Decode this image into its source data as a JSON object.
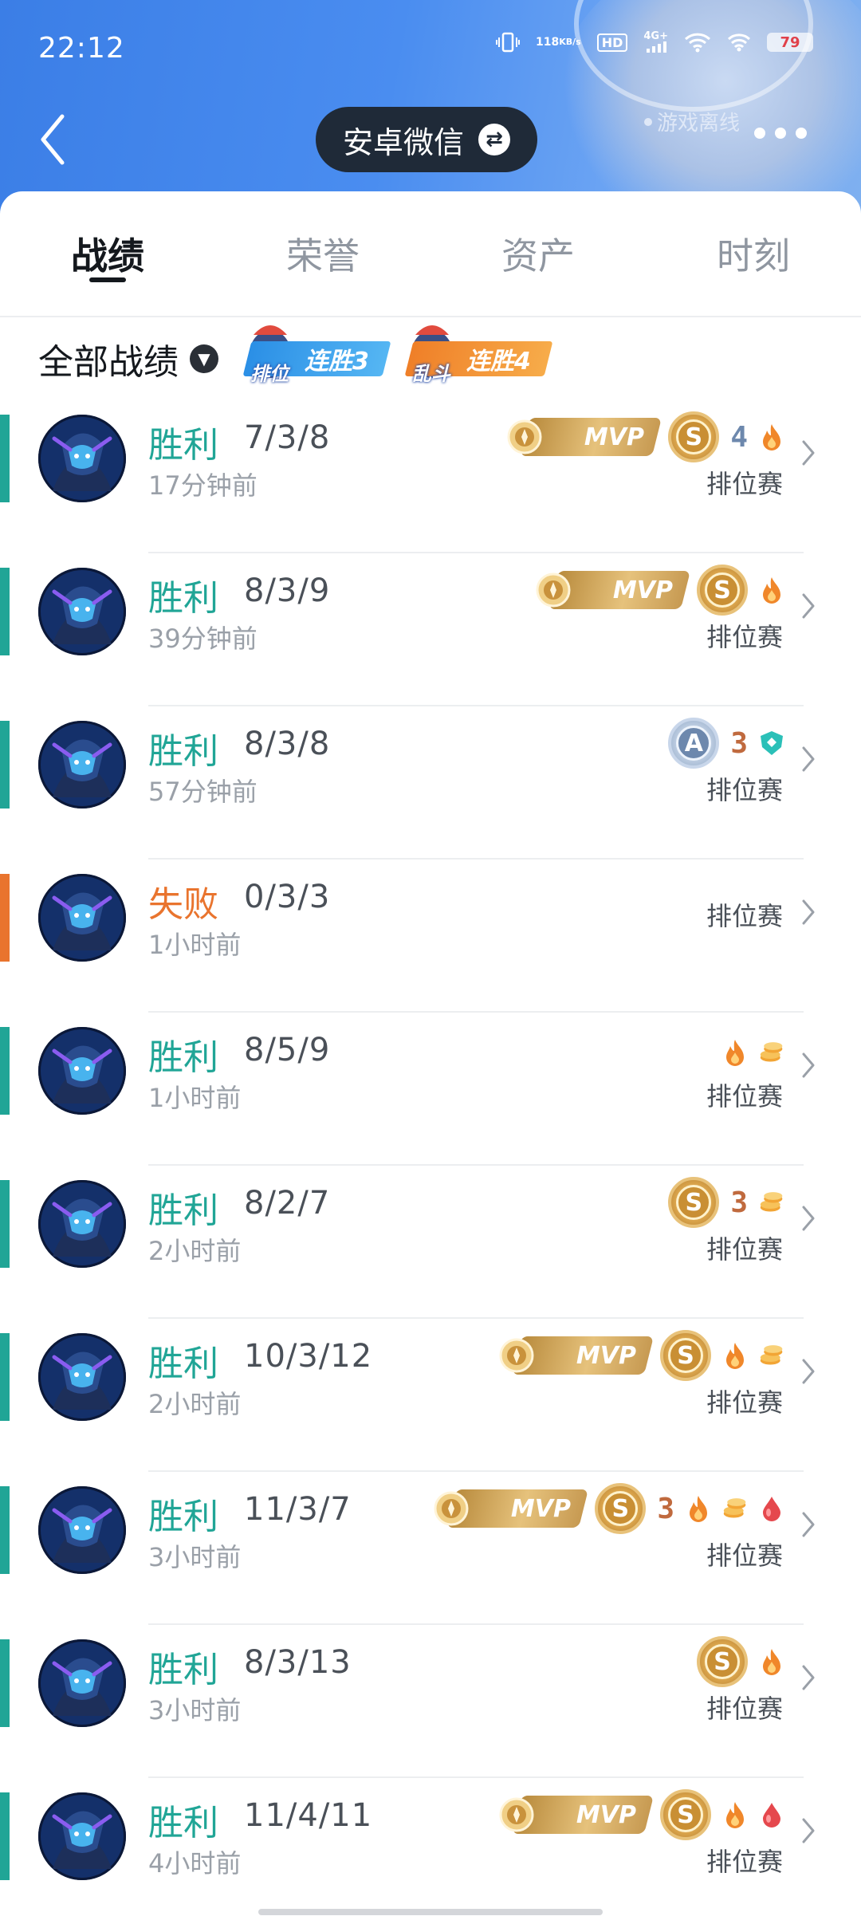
{
  "status_bar": {
    "time": "22:12",
    "speed_value": "118",
    "speed_unit": "KB/s",
    "hd": "HD",
    "network": "4G+",
    "battery": "79"
  },
  "header": {
    "account": "安卓微信",
    "presence": "游戏离线"
  },
  "tabs": [
    {
      "label": "战绩",
      "active": true
    },
    {
      "label": "荣誉",
      "active": false
    },
    {
      "label": "资产",
      "active": false
    },
    {
      "label": "时刻",
      "active": false
    }
  ],
  "filter": {
    "label": "全部战绩",
    "streaks": [
      {
        "mode": "排位",
        "text": "连胜3",
        "color": "#2f9be8"
      },
      {
        "mode": "乱斗",
        "text": "连胜4",
        "color": "#f08a2c"
      }
    ]
  },
  "colors": {
    "win": "#20a596",
    "loss": "#e9742e",
    "streak_num": "#c06a3e",
    "fire": "#f0872a",
    "coins": "#f2a535",
    "blood": "#e5484d",
    "shield": "#2bc0b8"
  },
  "matches": [
    {
      "result": "胜利",
      "outcome": "win",
      "kda": "7/3/8",
      "ago": "17分钟前",
      "mode": "排位赛",
      "badges": [
        {
          "type": "mvp",
          "label": "MVP"
        },
        {
          "type": "s",
          "label": "S"
        },
        {
          "type": "num",
          "label": "4",
          "color": "#6d88ad"
        },
        {
          "type": "fire-icon"
        }
      ]
    },
    {
      "result": "胜利",
      "outcome": "win",
      "kda": "8/3/9",
      "ago": "39分钟前",
      "mode": "排位赛",
      "badges": [
        {
          "type": "mvp",
          "label": "MVP"
        },
        {
          "type": "s",
          "label": "S"
        },
        {
          "type": "fire-icon"
        }
      ]
    },
    {
      "result": "胜利",
      "outcome": "win",
      "kda": "8/3/8",
      "ago": "57分钟前",
      "mode": "排位赛",
      "badges": [
        {
          "type": "a",
          "label": "A"
        },
        {
          "type": "num",
          "label": "3",
          "color": "#c06a3e"
        },
        {
          "type": "shield-icon"
        }
      ]
    },
    {
      "result": "失败",
      "outcome": "loss",
      "kda": "0/3/3",
      "ago": "1小时前",
      "mode": "排位赛",
      "badges": []
    },
    {
      "result": "胜利",
      "outcome": "win",
      "kda": "8/5/9",
      "ago": "1小时前",
      "mode": "排位赛",
      "badges": [
        {
          "type": "fire-icon"
        },
        {
          "type": "coins-icon"
        }
      ]
    },
    {
      "result": "胜利",
      "outcome": "win",
      "kda": "8/2/7",
      "ago": "2小时前",
      "mode": "排位赛",
      "badges": [
        {
          "type": "s",
          "label": "S"
        },
        {
          "type": "num",
          "label": "3",
          "color": "#c06a3e"
        },
        {
          "type": "coins-icon"
        }
      ]
    },
    {
      "result": "胜利",
      "outcome": "win",
      "kda": "10/3/12",
      "ago": "2小时前",
      "mode": "排位赛",
      "badges": [
        {
          "type": "mvp",
          "label": "MVP"
        },
        {
          "type": "s",
          "label": "S"
        },
        {
          "type": "fire-icon"
        },
        {
          "type": "coins-icon"
        }
      ]
    },
    {
      "result": "胜利",
      "outcome": "win",
      "kda": "11/3/7",
      "ago": "3小时前",
      "mode": "排位赛",
      "badges": [
        {
          "type": "mvp",
          "label": "MVP"
        },
        {
          "type": "s",
          "label": "S"
        },
        {
          "type": "num",
          "label": "3",
          "color": "#c06a3e"
        },
        {
          "type": "fire-icon"
        },
        {
          "type": "coins-icon"
        },
        {
          "type": "blood-icon"
        }
      ]
    },
    {
      "result": "胜利",
      "outcome": "win",
      "kda": "8/3/13",
      "ago": "3小时前",
      "mode": "排位赛",
      "badges": [
        {
          "type": "s",
          "label": "S"
        },
        {
          "type": "fire-icon"
        }
      ]
    },
    {
      "result": "胜利",
      "outcome": "win",
      "kda": "11/4/11",
      "ago": "4小时前",
      "mode": "排位赛",
      "badges": [
        {
          "type": "mvp",
          "label": "MVP"
        },
        {
          "type": "s",
          "label": "S"
        },
        {
          "type": "fire-icon"
        },
        {
          "type": "blood-icon"
        }
      ]
    }
  ]
}
